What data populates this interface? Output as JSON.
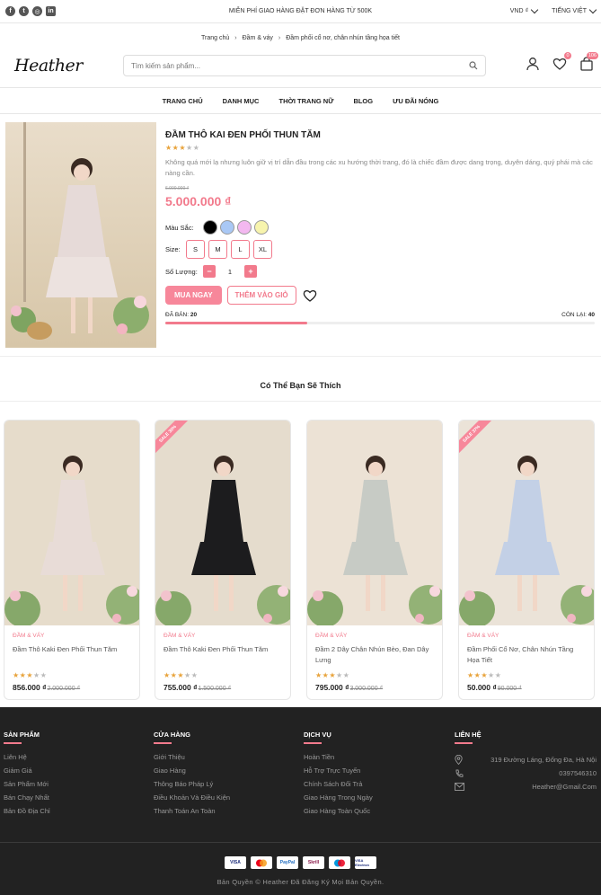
{
  "topbar": {
    "social": [
      "facebook-icon",
      "twitter-icon",
      "instagram-icon",
      "linkedin-icon"
    ],
    "promo": "MIỄN PHÍ GIAO HÀNG ĐẶT ĐƠN HÀNG TỪ 500K",
    "currency": "VND ₫",
    "language": "TIẾNG VIỆT"
  },
  "breadcrumb": [
    "Trang chủ",
    "Đầm & váy",
    "Đầm phối cổ nơ, chân nhún tầng họa tiết"
  ],
  "header": {
    "logo": "Heather",
    "search_placeholder": "Tìm kiếm sản phẩm...",
    "wishlist_count": "0",
    "cart_count": "106"
  },
  "nav": [
    "TRANG CHỦ",
    "DANH MỤC",
    "THỜI TRANG NỮ",
    "BLOG",
    "ƯU ĐÃI NÓNG"
  ],
  "product": {
    "title": "ĐẦM THÔ KAI ĐEN PHỐI THUN TĂM",
    "rating": 3,
    "description": "Không quá mới lạ nhưng luôn giữ vị trí dẫn đầu trong các xu hướng thời trang, đó là chiếc đầm được dang trọng, duyên dáng, quý phái mà các nàng cần.",
    "old_price": "6.000.000 ₫",
    "price": "5.000.000 ₫",
    "color_label": "Màu Sắc:",
    "colors": [
      "#000000",
      "#a9c8f5",
      "#f3b8f0",
      "#f7f4ad"
    ],
    "size_label": "Size:",
    "sizes": [
      "S",
      "M",
      "L",
      "XL"
    ],
    "qty_label": "Số Lượng:",
    "qty": "1",
    "buy_label": "MUA NGAY",
    "cart_label": "THÊM VÀO GIỎ",
    "sold_label": "ĐÃ BÁN:",
    "sold": "20",
    "remaining_label": "CÒN LẠI:",
    "remaining": "40",
    "sold_fraction": 0.33
  },
  "suggestions": {
    "title": "Có Thể Bạn Sẽ Thích",
    "items": [
      {
        "category": "ĐẦM & VÁY",
        "name": "Đầm Thô Kaki Đen Phối Thun Tăm",
        "rating": 3,
        "price": "856.000 ₫",
        "old_price": "2.000.000 ₫",
        "ribbon": "",
        "dress": "#e8dcd7"
      },
      {
        "category": "ĐẦM & VÁY",
        "name": "Đầm Thô Kaki Đen Phối Thun Tăm",
        "rating": 3,
        "price": "755.000 ₫",
        "old_price": "1.500.000 ₫",
        "ribbon": "SALE 30%",
        "dress": "#1c1c1e"
      },
      {
        "category": "ĐẦM & VÁY",
        "name": "Đầm 2 Dây Chân Nhún Bèo, Đan Dây Lưng",
        "rating": 3,
        "price": "795.000 ₫",
        "old_price": "3.000.000 ₫",
        "ribbon": "",
        "dress": "#c7cbc5"
      },
      {
        "category": "ĐẦM & VÁY",
        "name": "Đầm Phối Cổ Nơ, Chân Nhún Tầng Họa Tiết",
        "rating": 3,
        "price": "50.000 ₫",
        "old_price": "90.000 ₫",
        "ribbon": "SALE 37%",
        "dress": "#c3d0e6"
      }
    ]
  },
  "footer": {
    "products": {
      "title": "SẢN PHẨM",
      "items": [
        "Liên Hệ",
        "Giảm Giá",
        "Sản Phẩm Mới",
        "Bán Chạy Nhất",
        "Bản Đồ Địa Chỉ"
      ]
    },
    "store": {
      "title": "CỬA HÀNG",
      "items": [
        "Giới Thiệu",
        "Giao Hàng",
        "Thông Báo Pháp Lý",
        "Điều Khoản Và Điều Kiện",
        "Thanh Toán An Toàn"
      ]
    },
    "service": {
      "title": "DỊCH VỤ",
      "items": [
        "Hoàn Tiền",
        "Hỗ Trợ Trực Tuyến",
        "Chính Sách Đổi Trả",
        "Giao Hàng Trong Ngày",
        "Giao Hàng Toàn Quốc"
      ]
    },
    "contact": {
      "title": "LIÊN HỆ",
      "address": "319 Đường Láng, Đống Đa, Hà Nội",
      "phone": "0397546310",
      "email": "Heather@Gmail.Com"
    },
    "payments": [
      "VISA",
      "MC",
      "PayPal",
      "Skrill",
      "MC",
      "VISA Electron"
    ],
    "copyright": "Bản Quyền © Heather Đã Đăng Ký Mọi Bản Quyền."
  }
}
